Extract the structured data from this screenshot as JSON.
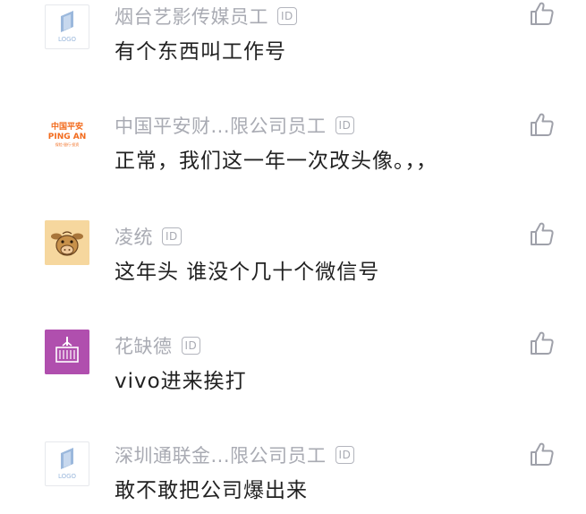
{
  "badge_label": "ID",
  "comments": [
    {
      "author": "烟台艺影传媒员工",
      "text": "有个东西叫工作号",
      "avatar": "logo-placeholder"
    },
    {
      "author": "中国平安财...限公司员工",
      "text": "正常，我们这一年一次改头像。，，",
      "avatar": "ping-an-logo"
    },
    {
      "author": "凌统",
      "text": "这年头 谁没个几十个微信号",
      "avatar": "cartoon-cow"
    },
    {
      "author": "花缺德",
      "text": "vivo进来挨打",
      "avatar": "purple-cargo"
    },
    {
      "author": "深圳通联金...限公司员工",
      "text": "敢不敢把公司爆出来",
      "avatar": "logo-placeholder"
    }
  ],
  "pingan_logo": {
    "line1": "中国平安",
    "line2": "PING AN",
    "line3": "保险·银行·投资"
  },
  "placeholder_logo_text": "LOGO",
  "colors": {
    "author": "#a9abb3",
    "text": "#222222",
    "like_icon": "#9fa1aa",
    "pingan_orange": "#f26b1d",
    "purple_avatar": "#b04fae",
    "logo_blue": "#9bb8dc"
  }
}
